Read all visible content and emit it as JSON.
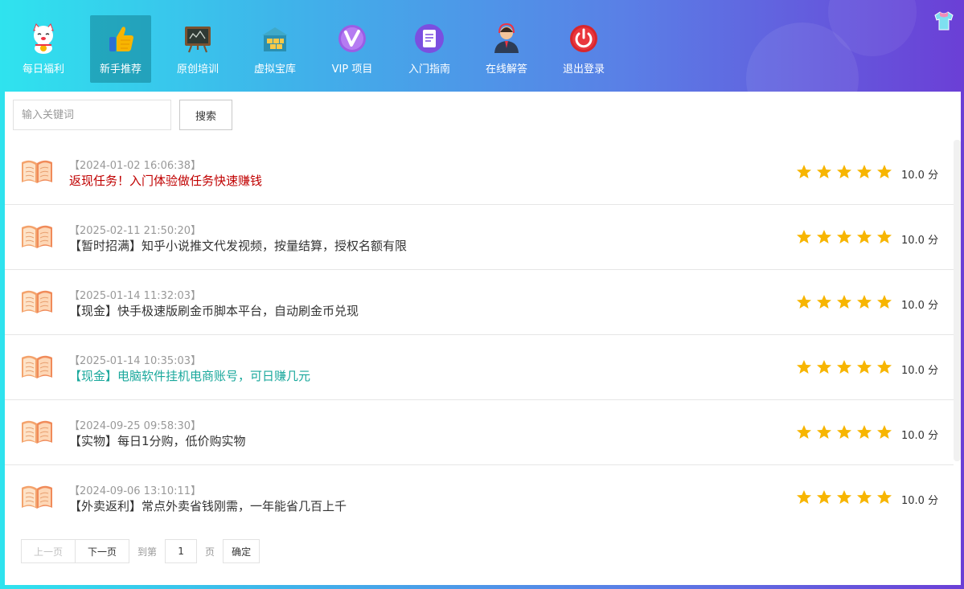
{
  "nav": {
    "items": [
      {
        "label": "每日福利",
        "icon": "lucky-cat-icon"
      },
      {
        "label": "新手推荐",
        "icon": "thumbs-up-icon",
        "active": true
      },
      {
        "label": "原创培训",
        "icon": "blackboard-icon"
      },
      {
        "label": "虚拟宝库",
        "icon": "treasure-chest-icon"
      },
      {
        "label": "VIP 项目",
        "icon": "vip-icon"
      },
      {
        "label": "入门指南",
        "icon": "document-icon"
      },
      {
        "label": "在线解答",
        "icon": "support-agent-icon"
      },
      {
        "label": "退出登录",
        "icon": "power-icon"
      }
    ],
    "skin_icon": "shirt-icon"
  },
  "search": {
    "placeholder": "输入关键词",
    "value": "",
    "button_label": "搜索"
  },
  "list": {
    "items": [
      {
        "date": "【2024-01-02 16:06:38】",
        "title": "返现任务！入门体验做任务快速赚钱",
        "title_color": "#c00000",
        "rating": 5,
        "score": "10.0 分"
      },
      {
        "date": "【2025-02-11 21:50:20】",
        "title": "【暂时招满】知乎小说推文代发视频，按量结算，授权名额有限",
        "title_color": "#333333",
        "rating": 5,
        "score": "10.0 分"
      },
      {
        "date": "【2025-01-14 11:32:03】",
        "title": "【现金】快手极速版刷金币脚本平台，自动刷金币兑现",
        "title_color": "#333333",
        "rating": 5,
        "score": "10.0 分"
      },
      {
        "date": "【2025-01-14 10:35:03】",
        "title": "【现金】电脑软件挂机电商账号，可日赚几元",
        "title_color": "#1aa89c",
        "rating": 5,
        "score": "10.0 分"
      },
      {
        "date": "【2024-09-25 09:58:30】",
        "title": "【实物】每日1分购，低价购实物",
        "title_color": "#333333",
        "rating": 5,
        "score": "10.0 分"
      },
      {
        "date": "【2024-09-06 13:10:11】",
        "title": "【外卖返利】常点外卖省钱刚需，一年能省几百上千",
        "title_color": "#333333",
        "rating": 5,
        "score": "10.0 分"
      }
    ]
  },
  "pager": {
    "prev_label": "上一页",
    "next_label": "下一页",
    "goto_label": "到第",
    "page_value": "1",
    "page_suffix": "页",
    "confirm_label": "确定"
  },
  "colors": {
    "star": "#f7b500",
    "active_nav": "#1e8fa0"
  }
}
